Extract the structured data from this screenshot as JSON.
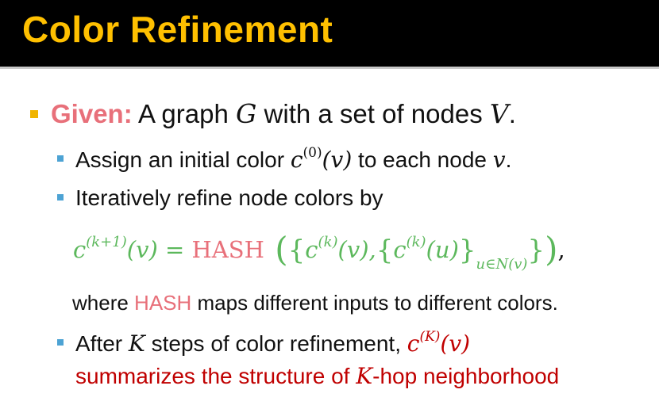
{
  "title": "Color Refinement",
  "colors": {
    "title_bar": "#000000",
    "title_text": "#ffc000",
    "given": "#e8707a",
    "formula": "#5cb85c",
    "hash": "#e8707a",
    "emphasis": "#c00000",
    "bullet_main": "#f0b400",
    "bullet_sub": "#4da3d4"
  },
  "bullet1": {
    "label": "Given:",
    "text_a": " A graph ",
    "var_g": "G",
    "text_b": " with a set of nodes ",
    "var_v": "V",
    "text_c": "."
  },
  "bullet2": {
    "text_a": "Assign an initial color ",
    "c": "c",
    "sup": "(0)",
    "arg": "(v)",
    "text_b": " to each node ",
    "var_v": "v",
    "text_c": "."
  },
  "bullet3": {
    "text": "Iteratively refine node colors by"
  },
  "formula": {
    "lhs_c": "c",
    "lhs_sup": "(k+1)",
    "lhs_arg": "(v)",
    "eq": " = ",
    "hash": "HASH",
    "open_paren": " (",
    "open_brace": "{",
    "c1": "c",
    "c1_sup": "(k)",
    "c1_arg": "(v),",
    "open_brace2": "{",
    "c2": "c",
    "c2_sup": "(k)",
    "c2_arg": "(u)",
    "close_brace2": "}",
    "sub": "u∈N(v)",
    "close_brace": "}",
    "close_paren": ")",
    "comma": ","
  },
  "where_line": {
    "text_a": "where ",
    "hash": "HASH",
    "text_b": " maps different inputs to different colors."
  },
  "bullet4": {
    "text_a": "After ",
    "var_k": "K",
    "text_b": " steps of color refinement, ",
    "c": "c",
    "sup": "(K)",
    "arg": "(v)"
  },
  "bullet4_line2": {
    "text_a": "summarizes the structure of ",
    "var_k": "K",
    "text_b": "-hop neighborhood"
  }
}
